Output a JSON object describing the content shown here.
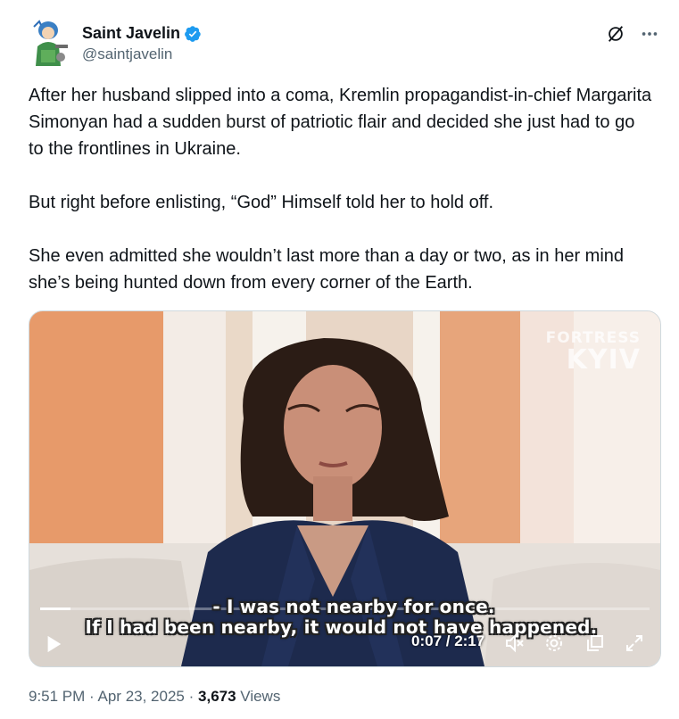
{
  "author": {
    "display_name": "Saint Javelin",
    "handle": "@saintjavelin",
    "verified": true,
    "avatar_icon": "illustrated-avatar-icon"
  },
  "actions": {
    "grok_icon": "grok-icon",
    "more_icon": "more-dots-icon"
  },
  "tweet": {
    "paragraphs": [
      "After her husband slipped into a coma, Kremlin propagandist-in-chief Margarita Simonyan had a sudden burst of patriotic flair and decided she just had to go to the frontlines in Ukraine.",
      "But right before enlisting, “God” Himself told her to hold off.",
      "She even admitted she wouldn’t last more than a day or two, as in her mind she’s being hunted down from every corner of the Earth."
    ]
  },
  "video": {
    "watermark_top": "FORTRESS",
    "watermark_bottom": "KYIV",
    "subtitle_line1": "- I was not nearby for once.",
    "subtitle_line2": "If I had been nearby, it would not have happened.",
    "time": "0:07 / 2:17",
    "progress": 0.05,
    "controls": [
      "play-icon",
      "mute-icon",
      "settings-icon",
      "popout-icon",
      "fullscreen-icon"
    ]
  },
  "meta": {
    "time": "9:51 PM",
    "separator": "·",
    "date": "Apr 23, 2025",
    "views_count": "3,673",
    "views_label": "Views"
  },
  "colors": {
    "verified_blue": "#1d9bf0",
    "secondary_text": "#536471",
    "primary_text": "#0f1419"
  }
}
